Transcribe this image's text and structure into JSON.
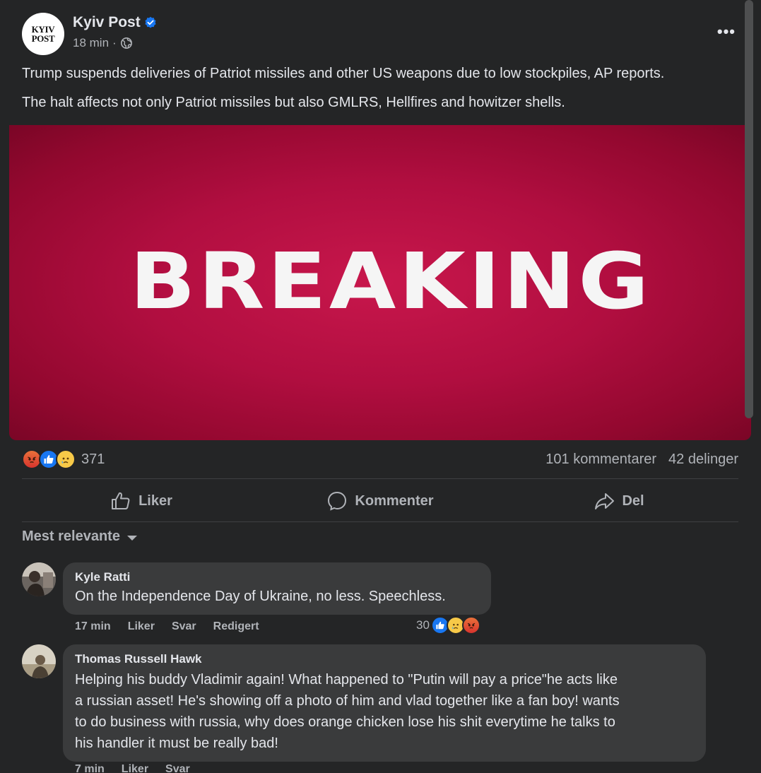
{
  "post": {
    "page_name": "Kyiv Post",
    "avatar_line1": "KYIV",
    "avatar_line2": "POST",
    "time": "18 min",
    "time_separator": "·",
    "text_line1": "Trump suspends deliveries of Patriot missiles and other US weapons due to low stockpiles, AP reports.",
    "text_line2": "The halt affects not only Patriot missiles but also GMLRS, Hellfires and howitzer shells.",
    "image_text": "BREAKING",
    "image_color": "#b10e40"
  },
  "stats": {
    "reactions": [
      "angry",
      "like",
      "sad"
    ],
    "reaction_count": "371",
    "comments": "101 kommentarer",
    "shares": "42 delinger"
  },
  "actions": {
    "like_label": "Liker",
    "comment_label": "Kommenter",
    "share_label": "Del"
  },
  "sort": {
    "label": "Mest relevante"
  },
  "comments": [
    {
      "author": "Kyle Ratti",
      "text": "On the Independence Day of Ukraine, no less. Speechless.",
      "time": "17 min",
      "like": "Liker",
      "reply": "Svar",
      "edited": "Redigert",
      "reaction_count": "30",
      "reactions": [
        "like",
        "sad",
        "angry"
      ]
    },
    {
      "author": "Thomas Russell Hawk",
      "text_lines": [
        "Helping his buddy Vladimir again! What happened to \"Putin will pay a price\"he acts like",
        "a russian asset! He's showing off a photo of him and vlad together like a fan boy! wants",
        "to do business with russia, why does orange chicken lose his shit everytime he talks to",
        "his handler it must be really bad!"
      ],
      "time": "7 min",
      "like": "Liker",
      "reply": "Svar"
    }
  ],
  "colors": {
    "background": "#242526",
    "bubble": "#3a3b3c",
    "text_primary": "#e4e6eb",
    "text_secondary": "#b0b3b8",
    "verified": "#1877f2"
  }
}
